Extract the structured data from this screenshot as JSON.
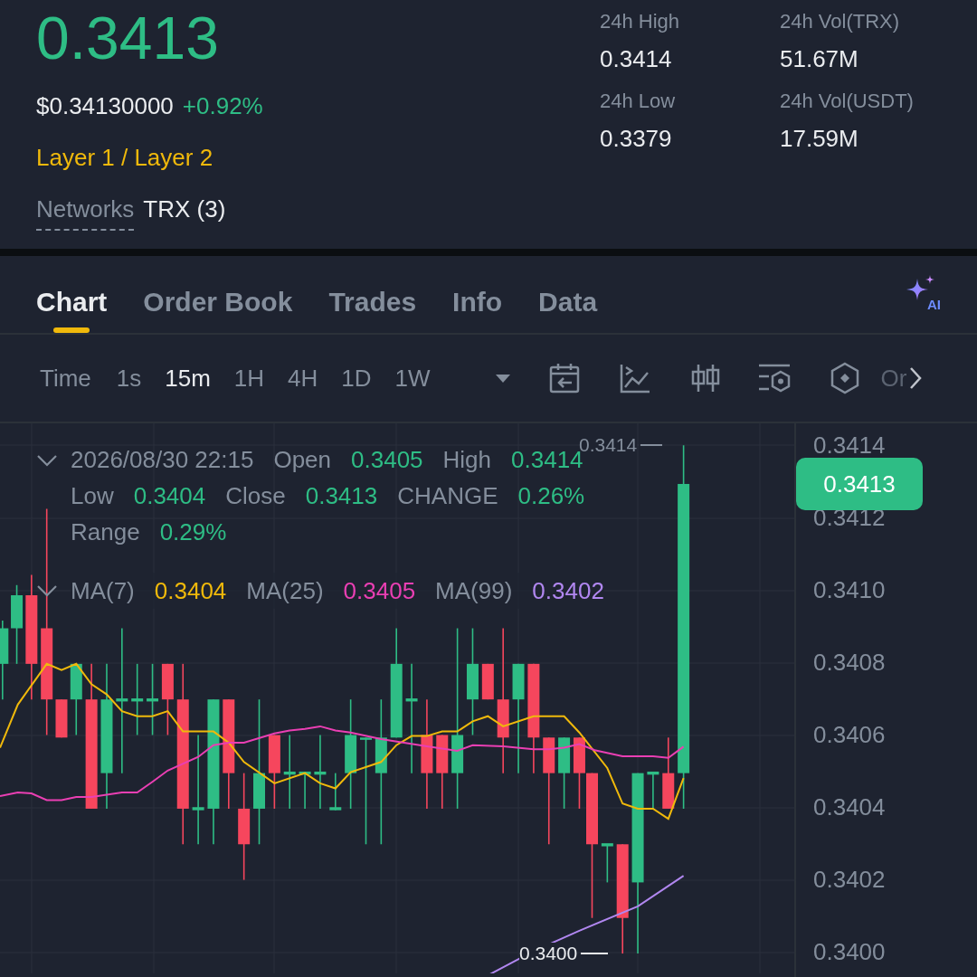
{
  "ticker": {
    "price": "0.3413",
    "usd_price": "$0.34130000",
    "change": "+0.92%",
    "category": "Layer 1 / Layer 2",
    "networks_label": "Networks",
    "networks_value": "TRX (3)"
  },
  "stats": [
    {
      "label": "24h High",
      "value": "0.3414"
    },
    {
      "label": "24h Vol(TRX)",
      "value": "51.67M"
    },
    {
      "label": "24h Low",
      "value": "0.3379"
    },
    {
      "label": "24h Vol(USDT)",
      "value": "17.59M"
    }
  ],
  "tabs": [
    {
      "label": "Chart",
      "selected": true
    },
    {
      "label": "Order Book",
      "selected": false
    },
    {
      "label": "Trades",
      "selected": false
    },
    {
      "label": "Info",
      "selected": false
    },
    {
      "label": "Data",
      "selected": false
    }
  ],
  "ai_badge": "AI",
  "time_label": "Time",
  "intervals": [
    {
      "label": "1s",
      "selected": false
    },
    {
      "label": "15m",
      "selected": true
    },
    {
      "label": "1H",
      "selected": false
    },
    {
      "label": "4H",
      "selected": false
    },
    {
      "label": "1D",
      "selected": false
    },
    {
      "label": "1W",
      "selected": false
    }
  ],
  "toolbar_overflow": "Or",
  "chart": {
    "date": "2026/08/30 22:15",
    "fields": [
      {
        "label": "Open",
        "value": "0.3405"
      },
      {
        "label": "High",
        "value": "0.3414"
      },
      {
        "label": "Low",
        "value": "0.3404"
      },
      {
        "label": "Close",
        "value": "0.3413"
      },
      {
        "label": "CHANGE",
        "value": "0.26%"
      },
      {
        "label": "Range",
        "value": "0.29%"
      }
    ],
    "moving_averages": [
      {
        "label": "MA(7)",
        "value": "0.3404",
        "color": "#f0b90b"
      },
      {
        "label": "MA(25)",
        "value": "0.3405",
        "color": "#ea3fb3"
      },
      {
        "label": "MA(99)",
        "value": "0.3402",
        "color": "#b187f0"
      }
    ],
    "price_axis": [
      "0.3414",
      "0.3412",
      "0.3410",
      "0.3408",
      "0.3406",
      "0.3404",
      "0.3402",
      "0.3400"
    ],
    "last_price": "0.3413",
    "high_marker": "0.3414",
    "low_marker": "0.3400"
  }
}
